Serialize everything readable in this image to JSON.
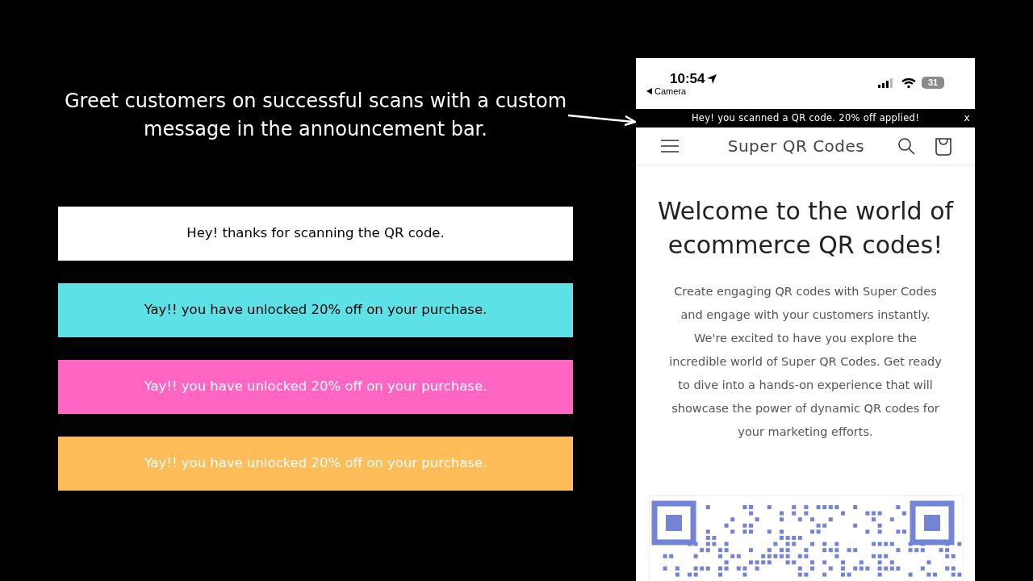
{
  "headline": "Greet customers on successful scans with a custom message in the announcement bar.",
  "examples": [
    {
      "text": "Hey! thanks for scanning the QR code.",
      "color": "#ffffff",
      "kind": "dark"
    },
    {
      "text": "Yay!! you have unlocked 20% off on your purchase.",
      "color": "#5ce1e6",
      "kind": "dark"
    },
    {
      "text": "Yay!! you have unlocked 20% off on your purchase.",
      "color": "#ff66c4",
      "kind": "light"
    },
    {
      "text": "Yay!! you have unlocked 20% off on your purchase.",
      "color": "#ffbd59",
      "kind": "light"
    }
  ],
  "phone": {
    "time": "10:54",
    "back_label": "Camera",
    "battery": "31",
    "announcement": {
      "text": "Hey! you scanned a QR code. 20% off applied!",
      "close": "x"
    },
    "store_name": "Super QR Codes",
    "heading": "Welcome to the world of ecommerce QR codes!",
    "body": "Create engaging QR codes with Super Codes and engage with your customers instantly. We're excited to have you explore the incredible world of Super QR Codes. Get ready to dive into a hands-on experience that will showcase the power of dynamic QR codes for your marketing efforts."
  }
}
